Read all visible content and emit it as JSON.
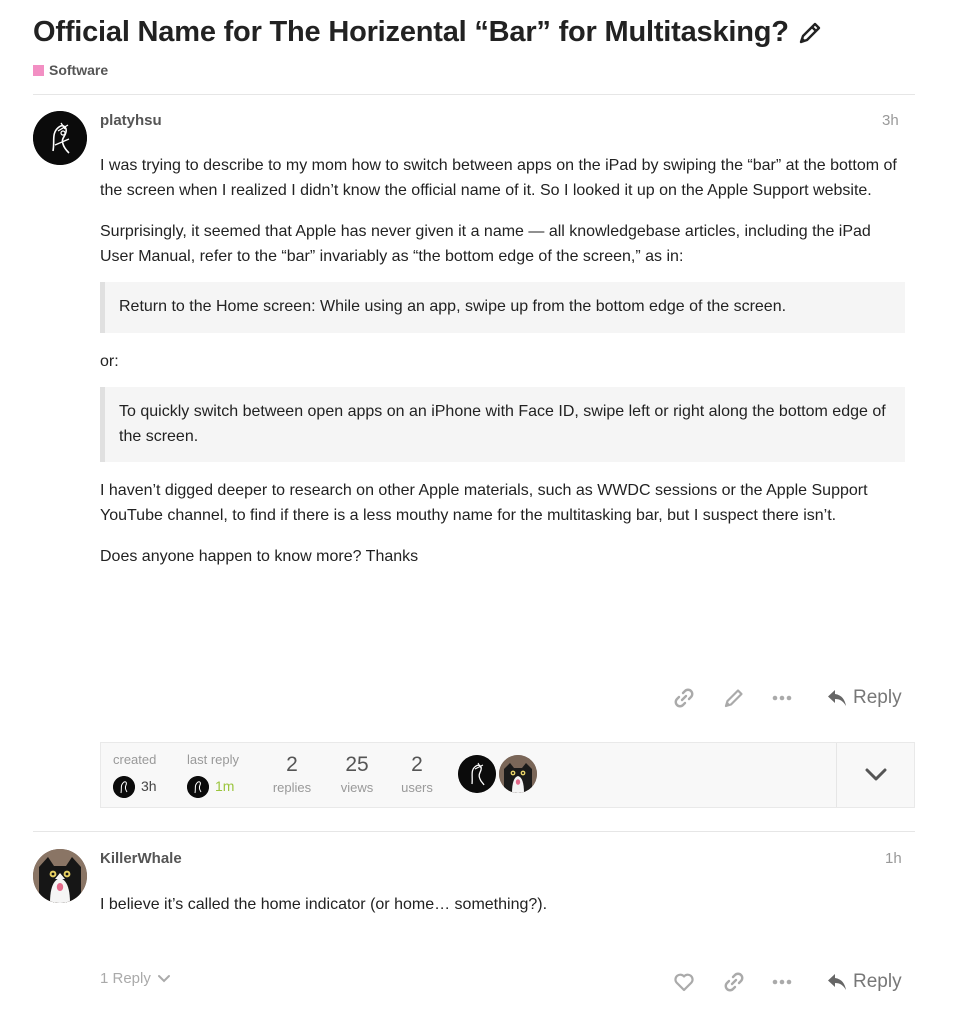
{
  "topic": {
    "title": "Official Name for The Horizental “Bar” for Multitasking?",
    "category": "Software",
    "category_color": "#f28fc3"
  },
  "posts": [
    {
      "username": "platyhsu",
      "date": "3h",
      "paragraphs": [
        "I was trying to describe to my mom how to switch between apps on the iPad by swiping the “bar” at the bottom of the screen when I realized I didn’t know the official name of it. So I looked it up on the Apple Support website.",
        "Surprisingly, it seemed that Apple has never given it a name — all knowledgebase articles, including the iPad User Manual, refer to the “bar” invariably as “the bottom edge of the screen,” as in:",
        "or:",
        "I haven’t digged deeper to research on other Apple materials, such as WWDC sessions or the Apple Support YouTube channel, to find if there is a less mouthy name for the multitasking bar, but I suspect there isn’t.",
        "Does anyone happen to know more? Thanks"
      ],
      "quotes": [
        "Return to the Home screen: While using an app, swipe up from the bottom edge of the screen.",
        "To quickly switch between open apps on an iPhone with Face ID, swipe left or right along the bottom edge of the screen."
      ],
      "reply_label": "Reply"
    },
    {
      "username": "KillerWhale",
      "date": "1h",
      "paragraphs": [
        "I believe it’s called the home indicator (or home… something?)."
      ],
      "replies_count_label": "1 Reply",
      "reply_label": "Reply"
    }
  ],
  "topic_map": {
    "created_label": "created",
    "created_time": "3h",
    "last_reply_label": "last reply",
    "last_reply_time": "1m",
    "last_reply_color": "#9bc53d",
    "replies_count": "2",
    "replies_label": "replies",
    "views_count": "25",
    "views_label": "views",
    "users_count": "2",
    "users_label": "users"
  },
  "icons": {
    "edit_title": "pencil-icon",
    "link": "link-icon",
    "edit": "pencil-icon",
    "more": "ellipsis-icon",
    "reply": "reply-arrow-icon",
    "like": "heart-icon",
    "expand": "chevron-down-icon"
  }
}
